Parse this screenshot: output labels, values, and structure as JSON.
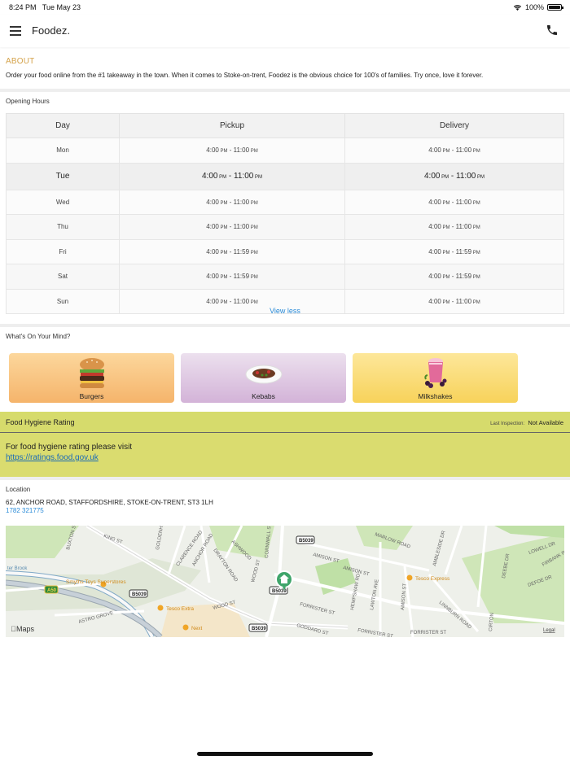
{
  "status_bar": {
    "time": "8:24 PM",
    "date": "Tue May 23",
    "battery": "100%"
  },
  "app": {
    "brand": "Foodez."
  },
  "about": {
    "title": "ABOUT",
    "text": "Order your food online from the #1 takeaway in the town. When it comes to Stoke-on-trent, Foodez is the obvious choice for 100's of families. Try once, love it forever."
  },
  "hours": {
    "title": "Opening Hours",
    "headers": [
      "Day",
      "Pickup",
      "Delivery"
    ],
    "rows": [
      {
        "day": "Mon",
        "pickup_open": "4:00",
        "pickup_close": "11:00",
        "delivery_open": "4:00",
        "delivery_close": "11:00"
      },
      {
        "day": "Tue",
        "pickup_open": "4:00",
        "pickup_close": "11:00",
        "delivery_open": "4:00",
        "delivery_close": "11:00"
      },
      {
        "day": "Wed",
        "pickup_open": "4:00",
        "pickup_close": "11:00",
        "delivery_open": "4:00",
        "delivery_close": "11:00"
      },
      {
        "day": "Thu",
        "pickup_open": "4:00",
        "pickup_close": "11:00",
        "delivery_open": "4:00",
        "delivery_close": "11:00"
      },
      {
        "day": "Fri",
        "pickup_open": "4:00",
        "pickup_close": "11:59",
        "delivery_open": "4:00",
        "delivery_close": "11:59"
      },
      {
        "day": "Sat",
        "pickup_open": "4:00",
        "pickup_close": "11:59",
        "delivery_open": "4:00",
        "delivery_close": "11:59"
      },
      {
        "day": "Sun",
        "pickup_open": "4:00",
        "pickup_close": "11:00",
        "delivery_open": "4:00",
        "delivery_close": "11:00"
      }
    ],
    "pm": "PM",
    "dash": " - ",
    "view_less": "View less"
  },
  "mind": {
    "title": "What's On Your Mind?",
    "categories": [
      {
        "label": "Burgers",
        "icon": "burger-icon"
      },
      {
        "label": "Kebabs",
        "icon": "kebab-plate-icon"
      },
      {
        "label": "Milkshakes",
        "icon": "milkshake-icon"
      }
    ]
  },
  "hygiene": {
    "title": "Food Hygiene Rating",
    "last_label": "Last Inspection:",
    "last_value": "Not Available",
    "text": "For food hygiene rating please visit",
    "link": "https://ratings.food.gov.uk"
  },
  "location": {
    "title": "Location",
    "address": "62, ANCHOR ROAD, STAFFORDSHIRE, STOKE-ON-TRENT, ST3 1LH",
    "phone": "1782 321775"
  },
  "map": {
    "attribution": "Maps",
    "legal": "Legal",
    "labels": {
      "king_st": "KING ST",
      "buxton": "BUXTON ST",
      "goldenhill": "GOLDENHILL",
      "clarence": "CLARENCE ROAD",
      "anchor": "ANCHOR ROAD",
      "drayton": "DRAYTON ROAD",
      "ashwood": "ASHWOOD",
      "wood_st": "WOOD ST",
      "cornwall": "CORNWALL ST",
      "amison1": "AMISON ST",
      "amison2": "AMISON ST",
      "marlow": "MARLOW ROAD",
      "ambleside": "AMBLESIDE DR",
      "lowell": "LOWELL DR",
      "firbank": "FIRBANK PL",
      "deebe": "DEEBE DR",
      "defoe": "DEFOE DR",
      "forrister1": "FORRISTER ST",
      "forrister2": "FORRISTER ST",
      "forrister3": "FORRISTER ST",
      "hempshaw": "HEMPSHAW RD",
      "lawton": "LAWTON AVE",
      "amison3": "AMISON ST",
      "linnburn": "LINNBURN ROAD",
      "goddard": "GODDARD ST",
      "astro": "ASTRO GROVE",
      "wood_rd": "WOOD ST",
      "cirton": "CIRTON",
      "brook": "ter Brook",
      "b5039a": "B5039",
      "b5039b": "B5039",
      "b5039c": "B5039",
      "b5039d": "B5039",
      "a50": "A50",
      "smyths": "Smyths Toys Superstores",
      "tesco_extra": "Tesco Extra",
      "tesco_express": "Tesco Express",
      "next": "Next"
    }
  }
}
